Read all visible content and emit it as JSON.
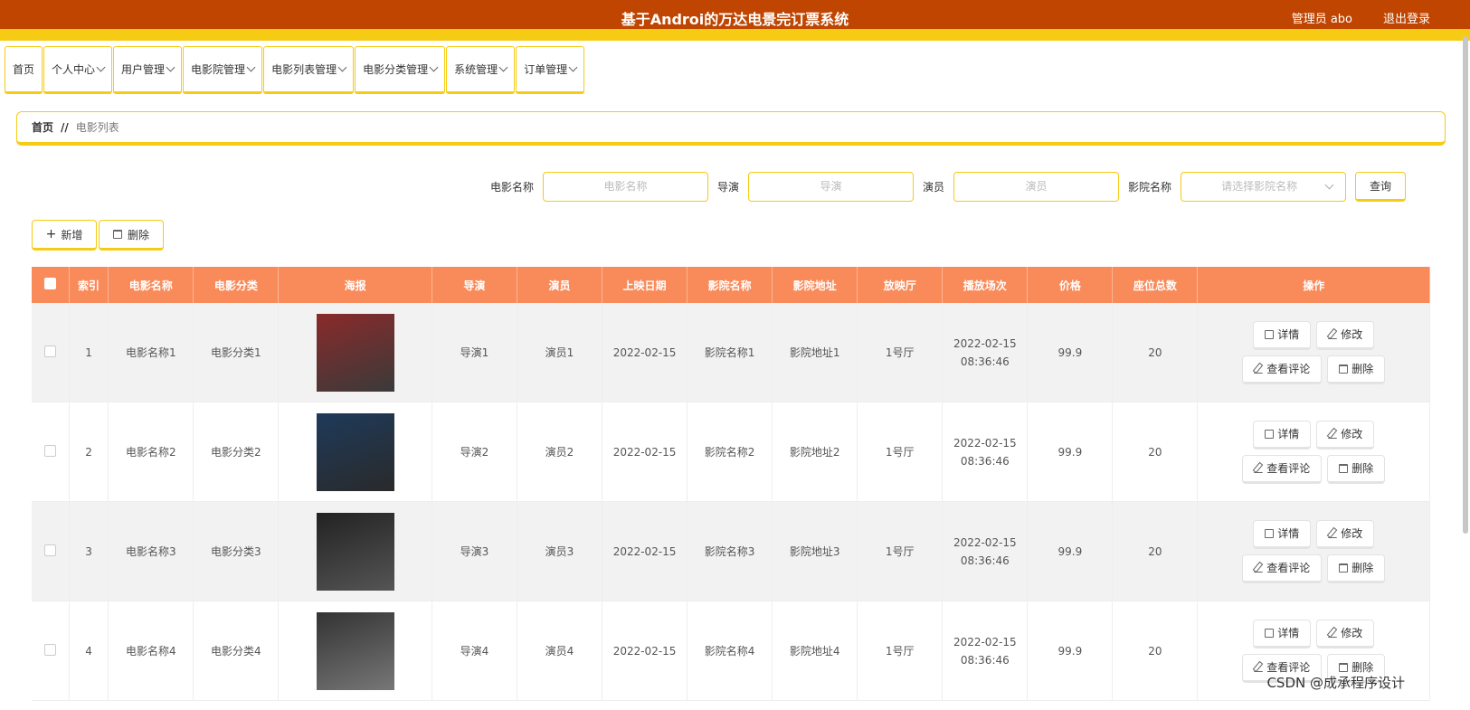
{
  "header": {
    "title": "基于Androi的万达电景完订票系统",
    "user": "管理员 abo",
    "logout": "退出登录"
  },
  "nav": [
    {
      "label": "首页",
      "dropdown": false
    },
    {
      "label": "个人中心",
      "dropdown": true
    },
    {
      "label": "用户管理",
      "dropdown": true
    },
    {
      "label": "电影院管理",
      "dropdown": true
    },
    {
      "label": "电影列表管理",
      "dropdown": true
    },
    {
      "label": "电影分类管理",
      "dropdown": true
    },
    {
      "label": "系统管理",
      "dropdown": true
    },
    {
      "label": "订单管理",
      "dropdown": true
    }
  ],
  "breadcrumb": {
    "home": "首页",
    "sep": "//",
    "current": "电影列表"
  },
  "search": {
    "name_label": "电影名称",
    "name_placeholder": "电影名称",
    "director_label": "导演",
    "director_placeholder": "导演",
    "actor_label": "演员",
    "actor_placeholder": "演员",
    "cinema_label": "影院名称",
    "cinema_placeholder": "请选择影院名称",
    "query_button": "查询"
  },
  "actions": {
    "add": "新增",
    "delete": "删除"
  },
  "table": {
    "headers": [
      "",
      "索引",
      "电影名称",
      "电影分类",
      "海报",
      "导演",
      "演员",
      "上映日期",
      "影院名称",
      "影院地址",
      "放映厅",
      "播放场次",
      "价格",
      "座位总数",
      "操作"
    ],
    "op_labels": {
      "detail": "详情",
      "edit": "修改",
      "comments": "查看评论",
      "delete": "删除"
    },
    "rows": [
      {
        "index": "1",
        "name": "电影名称1",
        "category": "电影分类1",
        "director": "导演1",
        "actor": "演员1",
        "release": "2022-02-15",
        "cinema": "影院名称1",
        "address": "影院地址1",
        "hall": "1号厅",
        "show_date": "2022-02-15",
        "show_time": "08:36:46",
        "price": "99.9",
        "seats": "20"
      },
      {
        "index": "2",
        "name": "电影名称2",
        "category": "电影分类2",
        "director": "导演2",
        "actor": "演员2",
        "release": "2022-02-15",
        "cinema": "影院名称2",
        "address": "影院地址2",
        "hall": "1号厅",
        "show_date": "2022-02-15",
        "show_time": "08:36:46",
        "price": "99.9",
        "seats": "20"
      },
      {
        "index": "3",
        "name": "电影名称3",
        "category": "电影分类3",
        "director": "导演3",
        "actor": "演员3",
        "release": "2022-02-15",
        "cinema": "影院名称3",
        "address": "影院地址3",
        "hall": "1号厅",
        "show_date": "2022-02-15",
        "show_time": "08:36:46",
        "price": "99.9",
        "seats": "20"
      },
      {
        "index": "4",
        "name": "电影名称4",
        "category": "电影分类4",
        "director": "导演4",
        "actor": "演员4",
        "release": "2022-02-15",
        "cinema": "影院名称4",
        "address": "影院地址4",
        "hall": "1号厅",
        "show_date": "2022-02-15",
        "show_time": "08:36:46",
        "price": "99.9",
        "seats": "20"
      }
    ]
  },
  "watermark": "CSDN @成承程序设计"
}
